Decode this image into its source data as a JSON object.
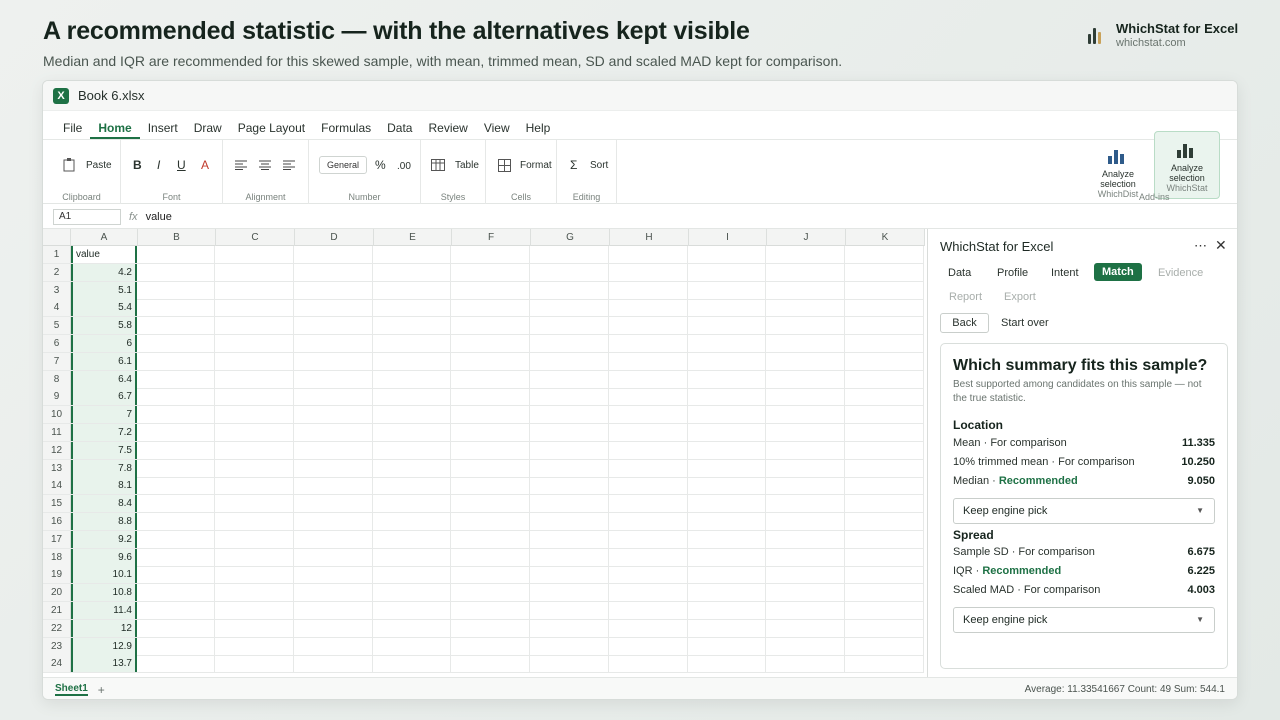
{
  "hero": {
    "title": "A recommended statistic — with the alternatives kept visible",
    "subtitle": "Median and IQR are recommended for this skewed sample, with mean, trimmed mean, SD and scaled MAD kept for comparison."
  },
  "brand": {
    "name": "WhichStat for Excel",
    "url": "whichstat.com"
  },
  "window": {
    "icon": "X",
    "doc_name": "Book 6.xlsx"
  },
  "menu": [
    "File",
    "Home",
    "Insert",
    "Draw",
    "Page Layout",
    "Formulas",
    "Data",
    "Review",
    "View",
    "Help"
  ],
  "ribbon": {
    "paste": "Paste",
    "clipboard": "Clipboard",
    "bold": "B",
    "italic": "I",
    "underline": "U",
    "font_color": "A",
    "font": "Font",
    "alignment": "Alignment",
    "general": "General",
    "percent": "%",
    "decimal": ".00",
    "number": "Number",
    "table": "Table",
    "styles": "Styles",
    "format": "Format",
    "cells": "Cells",
    "sigma": "Σ",
    "sort": "Sort",
    "editing": "Editing",
    "addins": "Add-ins",
    "addin1": {
      "line1": "Analyze",
      "line2": "selection",
      "sub": "WhichDist"
    },
    "addin2": {
      "line1": "Analyze",
      "line2": "selection",
      "sub": "WhichStat"
    }
  },
  "formula": {
    "cell": "A1",
    "fx": "fx",
    "value": "value"
  },
  "grid": {
    "columns": [
      "A",
      "B",
      "C",
      "D",
      "E",
      "F",
      "G",
      "H",
      "I",
      "J",
      "K"
    ],
    "header": "value",
    "values": [
      "4.2",
      "5.1",
      "5.4",
      "5.8",
      "6",
      "6.1",
      "6.4",
      "6.7",
      "7",
      "7.2",
      "7.5",
      "7.8",
      "8.1",
      "8.4",
      "8.8",
      "9.2",
      "9.6",
      "10.1",
      "10.8",
      "11.4",
      "12",
      "12.9",
      "13.7"
    ]
  },
  "panel": {
    "title": "WhichStat for Excel",
    "more": "⋯",
    "close": "✕",
    "tabs": [
      "Data",
      "Profile",
      "Intent",
      "Match",
      "Evidence",
      "Report",
      "Export"
    ],
    "back": "Back",
    "start_over": "Start over",
    "card": {
      "title": "Which summary fits this sample?",
      "subtitle": "Best supported among candidates on this sample — not the true statistic.",
      "location": {
        "title": "Location",
        "rows": [
          {
            "name": "Mean",
            "tag": "For comparison",
            "value": "11.335"
          },
          {
            "name": "10% trimmed mean",
            "tag": "For comparison",
            "value": "10.250"
          },
          {
            "name": "Median",
            "tag": "Recommended",
            "value": "9.050"
          }
        ],
        "dropdown": "Keep engine pick"
      },
      "spread": {
        "title": "Spread",
        "rows": [
          {
            "name": "Sample SD",
            "tag": "For comparison",
            "value": "6.675"
          },
          {
            "name": "IQR",
            "tag": "Recommended",
            "value": "6.225"
          },
          {
            "name": "Scaled MAD",
            "tag": "For comparison",
            "value": "4.003"
          }
        ],
        "dropdown": "Keep engine pick"
      }
    }
  },
  "status": {
    "sheet": "Sheet1",
    "add": "+",
    "summary": "Average: 11.33541667   Count: 49   Sum: 544.1"
  },
  "colors": {
    "accent": "#1e7145",
    "cell_fill": "#e8f3ec"
  }
}
